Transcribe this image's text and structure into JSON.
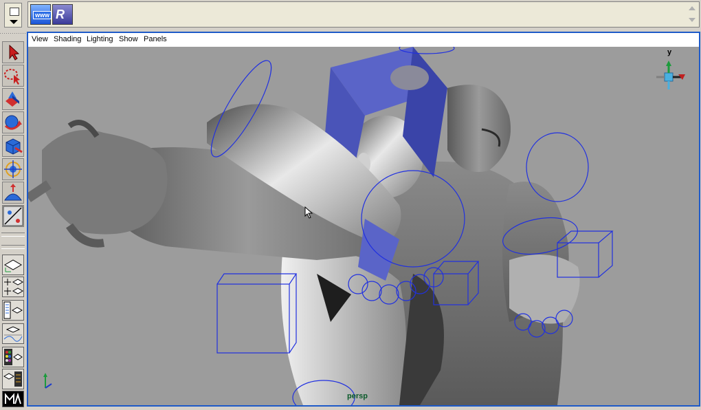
{
  "shelf": {
    "web_button": {
      "label": "www",
      "icon": "web-browser-icon"
    },
    "render_button": {
      "label": "R",
      "icon": "render-icon"
    }
  },
  "panel_menu": {
    "items": [
      "View",
      "Shading",
      "Lighting",
      "Show",
      "Panels"
    ]
  },
  "viewport": {
    "camera_name": "persp",
    "view_cube_axis_label": "y"
  },
  "toolbox": {
    "tools": [
      {
        "name": "select-tool",
        "icon": "arrow-icon"
      },
      {
        "name": "lasso-tool",
        "icon": "lasso-icon"
      },
      {
        "name": "move-tool",
        "icon": "move-icon"
      },
      {
        "name": "rotate-tool",
        "icon": "rotate-icon"
      },
      {
        "name": "scale-tool",
        "icon": "scale-icon"
      },
      {
        "name": "universal-manipulator",
        "icon": "manipulator-icon"
      },
      {
        "name": "soft-modification-tool",
        "icon": "soft-mod-icon"
      },
      {
        "name": "show-manipulator",
        "icon": "show-manip-icon"
      }
    ]
  },
  "colors": {
    "viewport_bg": "#9c9c9c",
    "frame": "#1e5ac8",
    "wire": "#2030e0",
    "model_fill": "#b8b8b8",
    "axis_y": "#1c9b3c",
    "axis_z": "#1e3ccc"
  }
}
